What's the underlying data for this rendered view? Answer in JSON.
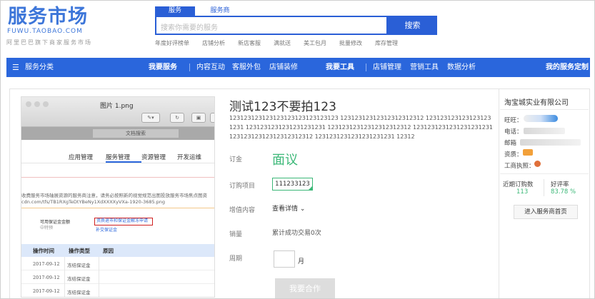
{
  "header": {
    "logo": "服务市场",
    "logo_sub": "FUWU.TAOBAO.COM",
    "slogan": "阿里巴巴旗下商家服务市场",
    "search_tabs": [
      "服务",
      "服务商"
    ],
    "search_placeholder": "搜索你需要的服务",
    "search_button": "搜索",
    "hot_links": [
      "年度好评榜单",
      "店铺分析",
      "新店客服",
      "满就送",
      "美工包月",
      "批量修改",
      "库存管理"
    ]
  },
  "nav": {
    "category": "服务分类",
    "my_service": "我要服务",
    "service_links": [
      "内容互动",
      "客服外包",
      "店铺装修"
    ],
    "my_tools": "我要工具",
    "tool_links": [
      "店铺管理",
      "营销工具",
      "数据分析"
    ],
    "custom": "我的服务定制"
  },
  "screenshot": {
    "file_title": "图片 1.png",
    "doc_search": "文档搜索",
    "tabs": [
      "应用管理",
      "服务管理",
      "资源管理",
      "开发运维"
    ],
    "notice_line1": "收费服务市场轴展资源的服务商注意，请务必按照新的视觉规范出图投放服务市场焦点图资",
    "notice_line2": "cdn.com/tfs/TB1RXgTeDtYBeNy1XdXXXXyVXa-1920-3685.png",
    "deposit_label": "可用保证金金额",
    "deposit_sub": "中特预",
    "apply_link": "资质退市和保证金解冻申请",
    "pay_link": "补交保证金",
    "table_headers": [
      "操作时间",
      "操作类型",
      "原因"
    ],
    "table_rows": [
      [
        "2017-09-12",
        "冻结保证金"
      ],
      [
        "2017-09-12",
        "冻结保证金"
      ],
      [
        "2017-09-12",
        "冻结保证金"
      ]
    ]
  },
  "product": {
    "title": "测试123不要拍123",
    "description": "123123123123123123123123123123 12312312312312312312312 1231231231231231231231 1231231231231231231231 12312312312312312312312 1231231231231231231231 12312312312312312312312 1231231231231231231231 12312",
    "price_label": "订金",
    "price": "面议",
    "option_label": "订购项目",
    "option_value": "111233123",
    "addon_label": "增值内容",
    "addon_value": "查看详情",
    "sales_label": "销量",
    "sales_value": "累计成功交易0次",
    "period_label": "周期",
    "period_unit": "月",
    "order_button": "我要合作"
  },
  "seller": {
    "name": "淘宝城实业有限公司",
    "wangwang_label": "旺旺：",
    "phone_label": "电话：",
    "email_label": "邮箱",
    "qualification_label": "资质：",
    "license_label": "工商执照：",
    "orders_label": "近期订购数",
    "orders_value": "113",
    "rating_label": "好评率",
    "rating_value": "83.78 %",
    "shop_button": "进入服务商首页"
  },
  "colors": {
    "brand_blue": "#2a66dc",
    "accent_green": "#3cb878"
  }
}
